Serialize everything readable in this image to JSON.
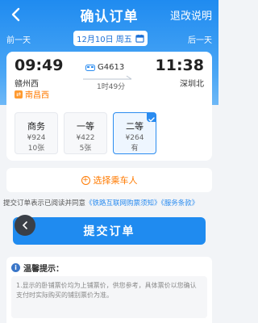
{
  "header": {
    "title": "确认订单",
    "help_label": "退改说明"
  },
  "date_bar": {
    "prev_label": "前一天",
    "next_label": "后一天",
    "date_text": "12月10日 周五"
  },
  "trip": {
    "departure_time": "09:49",
    "departure_station": "赣州西",
    "transfer_station": "南昌西",
    "arrival_time": "11:38",
    "arrival_station": "深圳北",
    "train_number": "G4613",
    "duration": "1时49分"
  },
  "seats": [
    {
      "name": "商务",
      "price": "¥924",
      "availability": "10张"
    },
    {
      "name": "一等",
      "price": "¥422",
      "availability": "5张"
    },
    {
      "name": "二等",
      "price": "¥264",
      "availability": "有",
      "selected": true
    }
  ],
  "passenger": {
    "add_label": "选择乘车人"
  },
  "agreement": {
    "prefix": "提交订单表示已阅读并同意",
    "link1": "《铁路互联网购票须知》",
    "link2": "《服务条款》"
  },
  "submit": {
    "label": "提交订单"
  },
  "tips": {
    "title": "温馨提示：",
    "line1": "1.显示的卧铺票价均为上铺票价，供您参考，具体票价以您确认",
    "line2": "支付时实际购买的铺别票价为准。"
  },
  "colors": {
    "primary": "#1f8bf0",
    "accent": "#ff7a00"
  }
}
